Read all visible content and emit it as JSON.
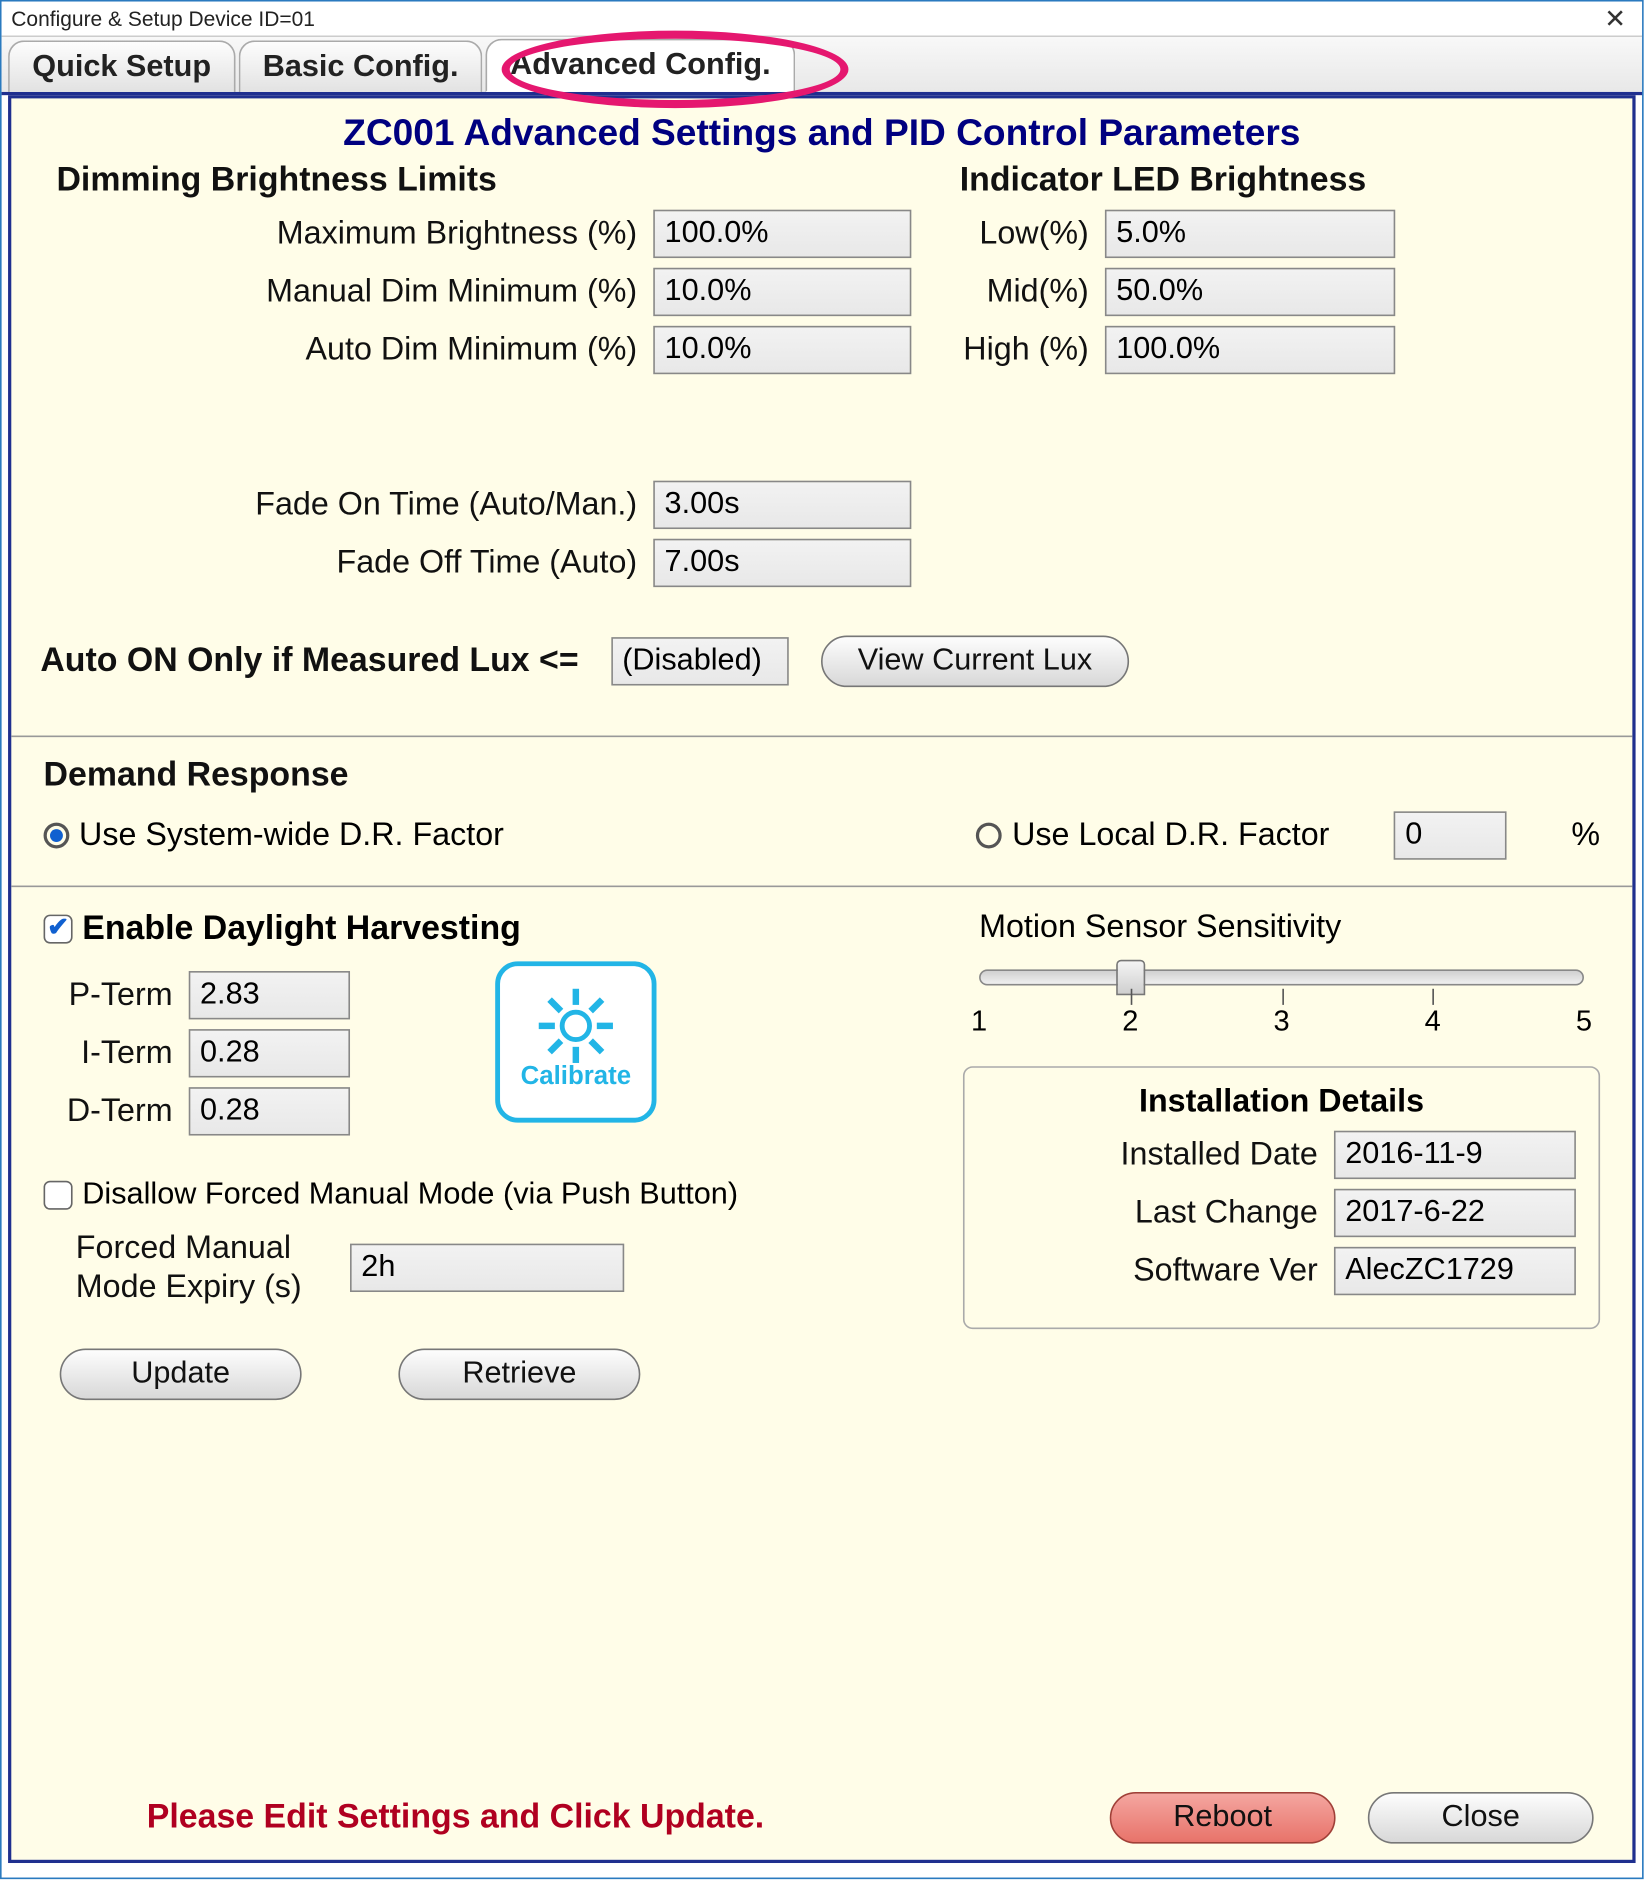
{
  "window": {
    "title": "Configure & Setup Device ID=01"
  },
  "tabs": {
    "quick": "Quick Setup",
    "basic": "Basic Config.",
    "advanced": "Advanced Config."
  },
  "panel": {
    "title": "ZC001 Advanced Settings and PID Control Parameters"
  },
  "dimming": {
    "heading": "Dimming Brightness Limits",
    "max_label": "Maximum Brightness (%)",
    "max_value": "100.0%",
    "manual_min_label": "Manual Dim Minimum (%)",
    "manual_min_value": "10.0%",
    "auto_min_label": "Auto Dim Minimum (%)",
    "auto_min_value": "10.0%"
  },
  "indicator": {
    "heading": "Indicator LED Brightness",
    "low_label": "Low(%)",
    "low_value": "5.0%",
    "mid_label": "Mid(%)",
    "mid_value": "50.0%",
    "high_label": "High (%)",
    "high_value": "100.0%"
  },
  "fade": {
    "on_label": "Fade On Time (Auto/Man.)",
    "on_value": "3.00s",
    "off_label": "Fade Off Time (Auto)",
    "off_value": "7.00s"
  },
  "auto_on": {
    "label": "Auto ON Only if Measured Lux <=",
    "value": "(Disabled)",
    "button": "View Current Lux"
  },
  "dr": {
    "heading": "Demand Response",
    "system_label": "Use System-wide D.R. Factor",
    "local_label": "Use Local D.R. Factor",
    "local_value": "0",
    "percent": "%"
  },
  "dh": {
    "enable_label": "Enable Daylight Harvesting",
    "p_label": "P-Term",
    "p_value": "2.83",
    "i_label": "I-Term",
    "i_value": "0.28",
    "d_label": "D-Term",
    "d_value": "0.28",
    "calibrate": "Calibrate"
  },
  "forced": {
    "disallow_label": "Disallow Forced Manual Mode (via Push Button)",
    "expiry_label": "Forced Manual Mode Expiry (s)",
    "expiry_value": "2h"
  },
  "motion": {
    "heading": "Motion Sensor Sensitivity",
    "ticks": {
      "t1": "1",
      "t2": "2",
      "t3": "3",
      "t4": "4",
      "t5": "5"
    }
  },
  "install": {
    "heading": "Installation Details",
    "date_label": "Installed Date",
    "date_value": "2016-11-9",
    "change_label": "Last Change",
    "change_value": "2017-6-22",
    "ver_label": "Software Ver",
    "ver_value": "AlecZC1729"
  },
  "buttons": {
    "update": "Update",
    "retrieve": "Retrieve",
    "reboot": "Reboot",
    "close": "Close"
  },
  "footer": {
    "message": "Please Edit Settings and Click Update."
  }
}
